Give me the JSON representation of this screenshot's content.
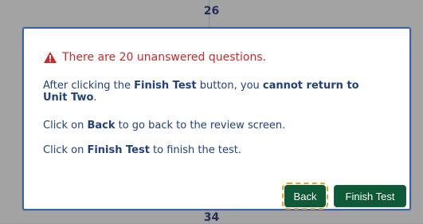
{
  "background": {
    "top_number": "26",
    "bottom_number": "34"
  },
  "dialog": {
    "warning_text": "There are 20 unanswered questions.",
    "paragraph1": {
      "part1": "After clicking the ",
      "part2": "Finish Test",
      "part3": " button, you ",
      "part4": "cannot return to Unit Two",
      "part5": "."
    },
    "paragraph2": {
      "part1": "Click on ",
      "part2": "Back",
      "part3": " to go back to the review screen."
    },
    "paragraph3": {
      "part1": "Click on ",
      "part2": "Finish Test",
      "part3": " to finish the test."
    }
  },
  "buttons": {
    "back": "Back",
    "finish_test": "Finish Test"
  },
  "colors": {
    "warning_red": "#c72b2b",
    "text_blue": "#23407f",
    "button_green": "#0e5a38",
    "focus_gold": "#e3a421",
    "dialog_border": "#3863a8"
  },
  "icons": {
    "warning": "warning-triangle-icon"
  }
}
